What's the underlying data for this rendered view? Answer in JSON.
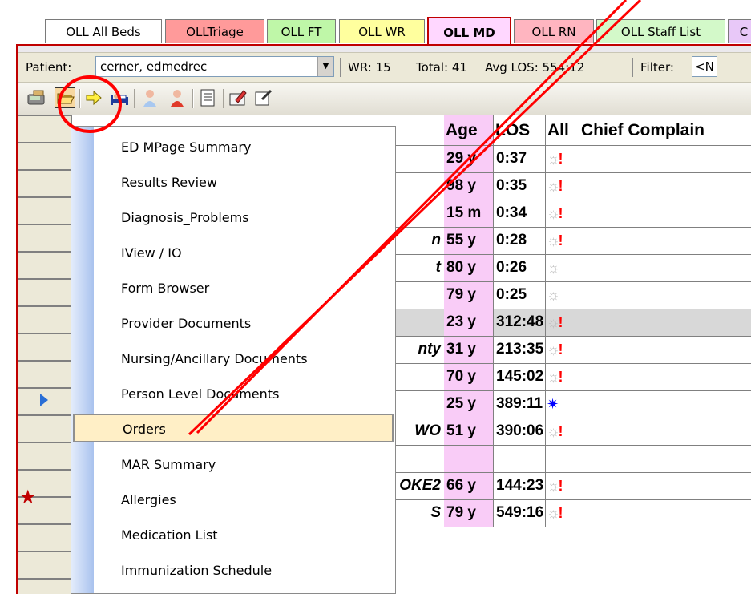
{
  "tabs": [
    {
      "label": "OLL All Beds",
      "color": "#ffffff"
    },
    {
      "label": "OLLTriage",
      "color": "#ff9a9a"
    },
    {
      "label": "OLL FT",
      "color": "#bff7a8"
    },
    {
      "label": "OLL WR",
      "color": "#ffff9e"
    },
    {
      "label": "OLL MD",
      "color": "#ffd7ff"
    },
    {
      "label": "OLL RN",
      "color": "#ffb5c0"
    },
    {
      "label": "OLL Staff List",
      "color": "#d3f9c9"
    },
    {
      "label": "C",
      "color": "#e8c8f8"
    }
  ],
  "patient_bar": {
    "patient_label": "Patient:",
    "patient_value": "cerner, edmedrec",
    "wr": "WR: 15",
    "total": "Total: 41",
    "avg_los": "Avg LOS: 554:12",
    "filter": "Filter:",
    "filter_value": "<N"
  },
  "toolbar": {
    "icons": [
      "pager-icon",
      "open-folder-icon",
      "arrow-right-icon",
      "bed-icon",
      "person-icon",
      "person-red-icon",
      "document-icon",
      "pen-folder-icon",
      "edit-icon"
    ]
  },
  "grid": {
    "headers": {
      "age": "Age",
      "los": "LOS",
      "all": "All",
      "chief": "Chief Complain"
    },
    "rows": [
      {
        "name": "",
        "age": "29 y",
        "los": "0:37",
        "all": "alert"
      },
      {
        "name": "",
        "age": "98 y",
        "los": "0:35",
        "all": "alert"
      },
      {
        "name": "",
        "age": "15 m",
        "los": "0:34",
        "all": "alert"
      },
      {
        "name": "n",
        "age": "55 y",
        "los": "0:28",
        "all": "alert"
      },
      {
        "name": "t",
        "age": "80 y",
        "los": "0:26",
        "all": "none"
      },
      {
        "name": "",
        "age": "79 y",
        "los": "0:25",
        "all": "none"
      },
      {
        "name": "",
        "age": "23 y",
        "los": "312:48",
        "all": "alert"
      },
      {
        "name": "nty",
        "age": "31 y",
        "los": "213:35",
        "all": "alert"
      },
      {
        "name": "",
        "age": "70 y",
        "los": "145:02",
        "all": "alert"
      },
      {
        "name": "",
        "age": "25 y",
        "los": "389:11",
        "all": "blue"
      },
      {
        "name": "WO",
        "age": "51 y",
        "los": "390:06",
        "all": "alert"
      },
      {
        "name": "",
        "age": "",
        "los": "",
        "all": ""
      },
      {
        "name": "OKE2",
        "age": "66 y",
        "los": "144:23",
        "all": "alert"
      },
      {
        "name": "S",
        "age": "79 y",
        "los": "549:16",
        "all": "alert"
      }
    ]
  },
  "menu": {
    "items": [
      "ED MPage Summary",
      "Results Review",
      "Diagnosis_Problems",
      "IView / IO",
      "Form Browser",
      "Provider Documents",
      "Nursing/Ancillary Documents",
      "Person Level Documents",
      "Orders",
      "MAR Summary",
      "Allergies",
      "Medication List",
      "Immunization Schedule"
    ],
    "highlighted_index": 8
  },
  "colors": {
    "accent_red": "#c00000",
    "annotation_red": "#ff0000"
  }
}
